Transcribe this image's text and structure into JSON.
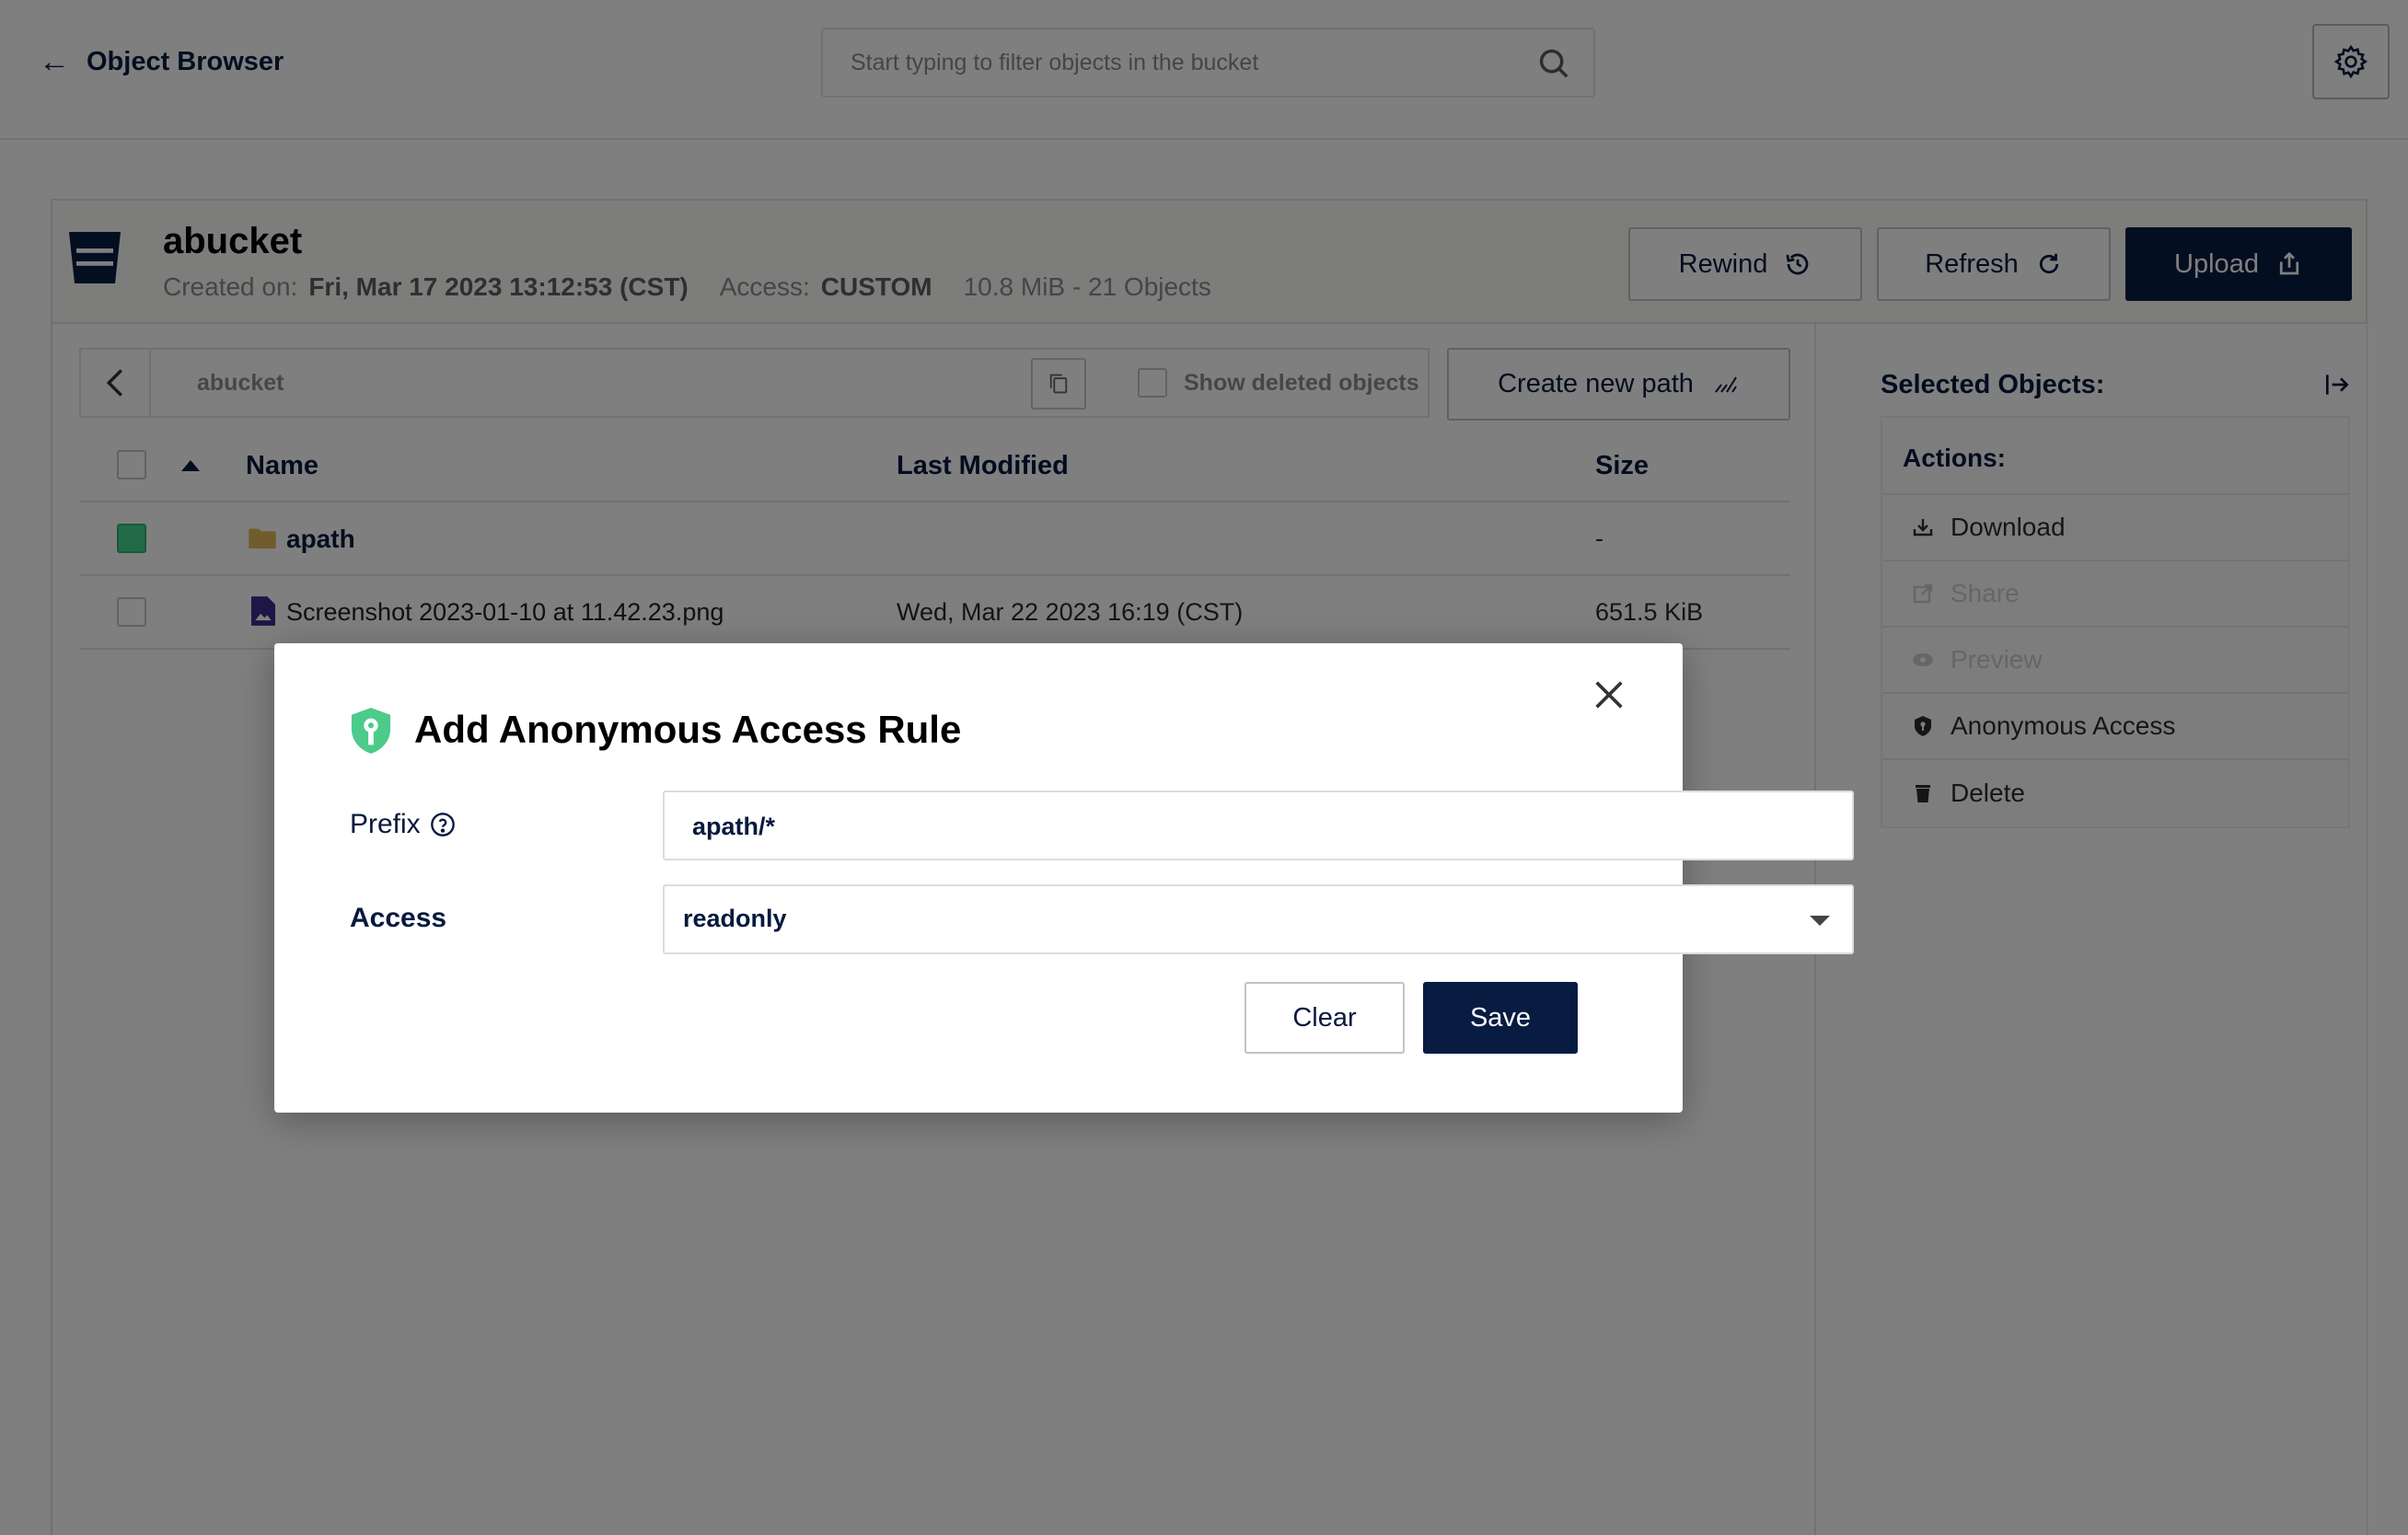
{
  "header": {
    "back_label": "Object Browser",
    "search_placeholder": "Start typing to filter objects in the bucket"
  },
  "bucket": {
    "name": "abucket",
    "created_label": "Created on:",
    "created_value": "Fri, Mar 17 2023 13:12:53 (CST)",
    "access_label": "Access:",
    "access_value": "CUSTOM",
    "usage": "10.8 MiB - 21 Objects",
    "rewind_label": "Rewind",
    "refresh_label": "Refresh",
    "upload_label": "Upload"
  },
  "browser": {
    "breadcrumb": "abucket",
    "show_deleted_label": "Show deleted objects",
    "create_path_label": "Create new path",
    "columns": {
      "name": "Name",
      "modified": "Last Modified",
      "size": "Size"
    },
    "rows": [
      {
        "name": "apath",
        "modified": "",
        "size": "-",
        "type": "folder",
        "selected": true
      },
      {
        "name": "Screenshot 2023-01-10 at 11.42.23.png",
        "modified": "Wed, Mar 22 2023 16:19 (CST)",
        "size": "651.5 KiB",
        "type": "file",
        "selected": false
      }
    ]
  },
  "side_panel": {
    "title": "Selected Objects:",
    "actions_title": "Actions:",
    "actions": [
      {
        "label": "Download",
        "icon": "download-icon",
        "enabled": true
      },
      {
        "label": "Share",
        "icon": "share-icon",
        "enabled": false
      },
      {
        "label": "Preview",
        "icon": "eye-icon",
        "enabled": false
      },
      {
        "label": "Anonymous Access",
        "icon": "shield-icon",
        "enabled": true
      },
      {
        "label": "Delete",
        "icon": "trash-icon",
        "enabled": true
      }
    ]
  },
  "modal": {
    "title": "Add Anonymous Access Rule",
    "prefix_label": "Prefix",
    "prefix_value": "apath/*",
    "access_label": "Access",
    "access_value": "readonly",
    "clear_label": "Clear",
    "save_label": "Save"
  },
  "colors": {
    "primary": "#081c42",
    "accent_green": "#47d591",
    "overlay": "rgba(0,0,0,0.5)"
  }
}
